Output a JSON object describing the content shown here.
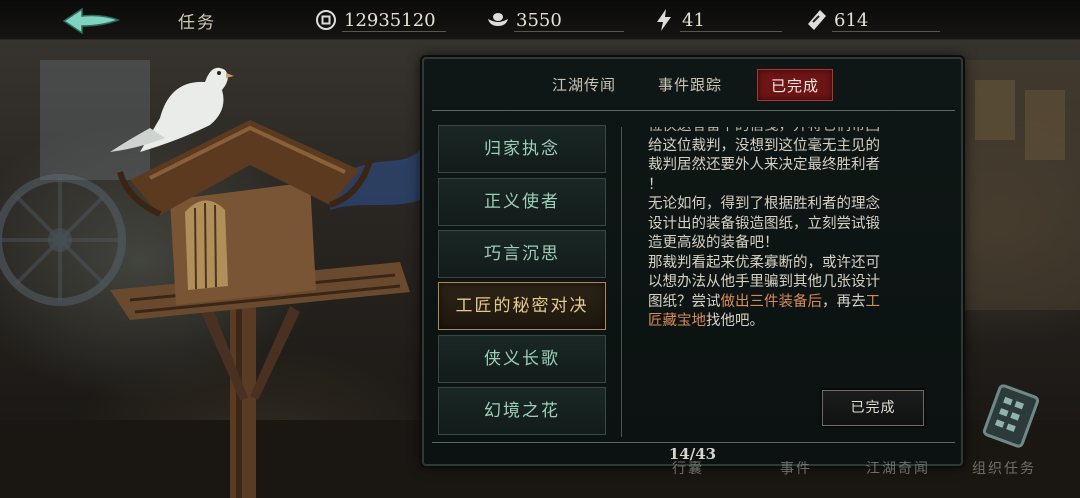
{
  "topbar": {
    "title": "任务",
    "resources": [
      {
        "icon": "coin-icon",
        "value": "12935120"
      },
      {
        "icon": "silver-ingot-icon",
        "value": "3550"
      },
      {
        "icon": "lightning-icon",
        "value": "41"
      },
      {
        "icon": "ticket-icon",
        "value": "614"
      }
    ]
  },
  "tabs": [
    {
      "label": "江湖传闻",
      "active": false
    },
    {
      "label": "事件跟踪",
      "active": false
    },
    {
      "label": "已完成",
      "active": true
    }
  ],
  "quests": [
    {
      "label": "归家执念",
      "active": false
    },
    {
      "label": "正义使者",
      "active": false
    },
    {
      "label": "巧言沉思",
      "active": false
    },
    {
      "label": "工匠的秘密对决",
      "active": true
    },
    {
      "label": "侠义长歌",
      "active": false
    },
    {
      "label": "幻境之花",
      "active": false
    }
  ],
  "description": {
    "line_partial": "位侠送者留下的信笺，并将它们带回",
    "line_1": "给这位裁判，没想到这位毫无主见的",
    "line_2": "裁判居然还要外人来决定最终胜利者",
    "line_3": "！",
    "line_4": "无论如何，得到了根据胜利者的理念",
    "line_5": "设计出的装备锻造图纸，立刻尝试锻",
    "line_6": "造更高级的装备吧！",
    "line_7": "那裁判看起来优柔寡断的，或许还可",
    "line_8": "以想办法从他手里骗到其他几张设计",
    "line_9_pre": "图纸？尝试",
    "line_9_hl1": "做出三件装备后",
    "line_9_mid": "，再去",
    "line_9_hl2": "工",
    "line_10_hl": "匠藏宝地",
    "line_10_post": "找他吧。"
  },
  "done_button": "已完成",
  "page_counter": "14/43",
  "bottom_nav": [
    "行囊",
    "事件",
    "江湖奇闻",
    "组织任务"
  ],
  "colors": {
    "active_tab_red": "#6d1414",
    "quest_text_green": "#9ccfb9",
    "active_quest_gold": "#e9c98e",
    "highlight_orange": "#d98a58"
  }
}
